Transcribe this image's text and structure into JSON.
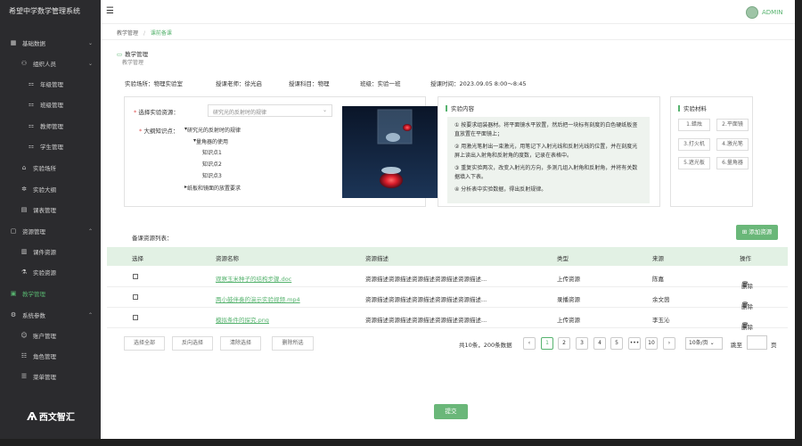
{
  "app": {
    "title": "希望中学数学管理系统"
  },
  "topbar": {
    "menu_icon": "hamburger-icon",
    "user": "ADMIN"
  },
  "sidebar": {
    "items": [
      {
        "label": "基础数据",
        "icon": "grid-icon",
        "chevron": "⌄",
        "level": 0
      },
      {
        "label": "组织人员",
        "icon": "people-icon",
        "chevron": "⌄",
        "level": 1
      },
      {
        "label": "年级管理",
        "icon": "org-icon",
        "level": 2
      },
      {
        "label": "班级管理",
        "icon": "org-icon",
        "level": 2
      },
      {
        "label": "教师管理",
        "icon": "org-icon",
        "level": 2
      },
      {
        "label": "学生管理",
        "icon": "org-icon",
        "level": 2
      },
      {
        "label": "实验场所",
        "icon": "location-icon",
        "level": 1
      },
      {
        "label": "实验大纲",
        "icon": "settings-icon",
        "level": 1
      },
      {
        "label": "课表管理",
        "icon": "calendar-icon",
        "level": 1
      },
      {
        "label": "资源管理",
        "icon": "folder-icon",
        "chevron": "⌃",
        "level": 0
      },
      {
        "label": "课件资源",
        "icon": "file-icon",
        "level": 1
      },
      {
        "label": "实验资源",
        "icon": "flask-icon",
        "level": 1
      },
      {
        "label": "教学管理",
        "icon": "book-icon",
        "level": 0,
        "active": true
      },
      {
        "label": "系统参数",
        "icon": "gear-icon",
        "chevron": "⌃",
        "level": 0
      },
      {
        "label": "账户管理",
        "icon": "user-icon",
        "level": 1
      },
      {
        "label": "角色管理",
        "icon": "role-icon",
        "level": 1
      },
      {
        "label": "菜单管理",
        "icon": "menu-icon",
        "level": 1
      }
    ],
    "logo": "西文智汇"
  },
  "breadcrumb": {
    "parent": "教学管理",
    "current": "课前备课"
  },
  "section": {
    "title": "教学管理",
    "subtitle": "教学管理"
  },
  "info": {
    "place": "实验场所：物理实验室",
    "teacher": "授课老师：徐光启",
    "subject": "授课科目：物理",
    "class": "班级：实验一班",
    "time": "授课时间：2023.09.05  8:00～8:45"
  },
  "resource_panel": {
    "select_label": "选择实验资源：",
    "select_value": "研究光的反射时的规律",
    "outline_label": "大纲知识点：",
    "tree": [
      "研究光的反射时的规律",
      "量角器的使用",
      "知识点1",
      "知识点2",
      "知识点3",
      "纸板和镜面的放置要求"
    ]
  },
  "content_panel": {
    "title": "实验内容",
    "steps": [
      "① 按要求组装器材。将平面镜水平放置，然后把一块标有刻度的白色硬纸板竖直放置在平面镜上；",
      "② 用激光笔射出一束激光，用笔记下入射光线和反射光线的位置，并在刻度光屏上读出入射角和反射角的度数，记录在表格中。",
      "③ 重复实验两次，改变入射光的方向，多测几组入射角和反射角，并将有关数据填入下表。",
      "④ 分析表中实验数据，得出反射规律。"
    ]
  },
  "materials_panel": {
    "title": "实验材料",
    "items": [
      "1.蜡烛",
      "2.平面镜",
      "3.打火机",
      "4.激光笔",
      "5.遮光板",
      "6.量角器"
    ]
  },
  "list": {
    "label": "备课资源列表：",
    "add_button": "添加资源",
    "headers": [
      "选择",
      "资源名称",
      "资源描述",
      "类型",
      "来源",
      "操作"
    ],
    "rows": [
      {
        "name": "观察玉米种子的结构步骤.doc",
        "desc": "资源描述资源描述资源描述资源描述资源描述...",
        "type": "上传资源",
        "source": "陈嘉",
        "action": "删除"
      },
      {
        "name": "两小鼓伴奏的演示实验视频.mp4",
        "desc": "资源描述资源描述资源描述资源描述资源描述...",
        "type": "录播资源",
        "source": "余文茵",
        "action": "删除"
      },
      {
        "name": "模拟条件的探究.png",
        "desc": "资源描述资源描述资源描述资源描述资源描述...",
        "type": "上传资源",
        "source": "李玉沁",
        "action": "删除"
      }
    ]
  },
  "bulk": {
    "select_all": "选择全部",
    "invert": "反向选择",
    "clear": "清除选择",
    "delete": "删除所选"
  },
  "pagination": {
    "total": "共10条，200条数据",
    "pages": [
      "1",
      "2",
      "3",
      "4",
      "5",
      "•••",
      "10"
    ],
    "current": "1",
    "page_size": "10条/页 ⌄",
    "jump_label": "跳至",
    "jump_suffix": "页"
  },
  "submit_label": "提交",
  "colors": {
    "accent": "#57b36f",
    "sidebar": "#2b2b2e"
  }
}
